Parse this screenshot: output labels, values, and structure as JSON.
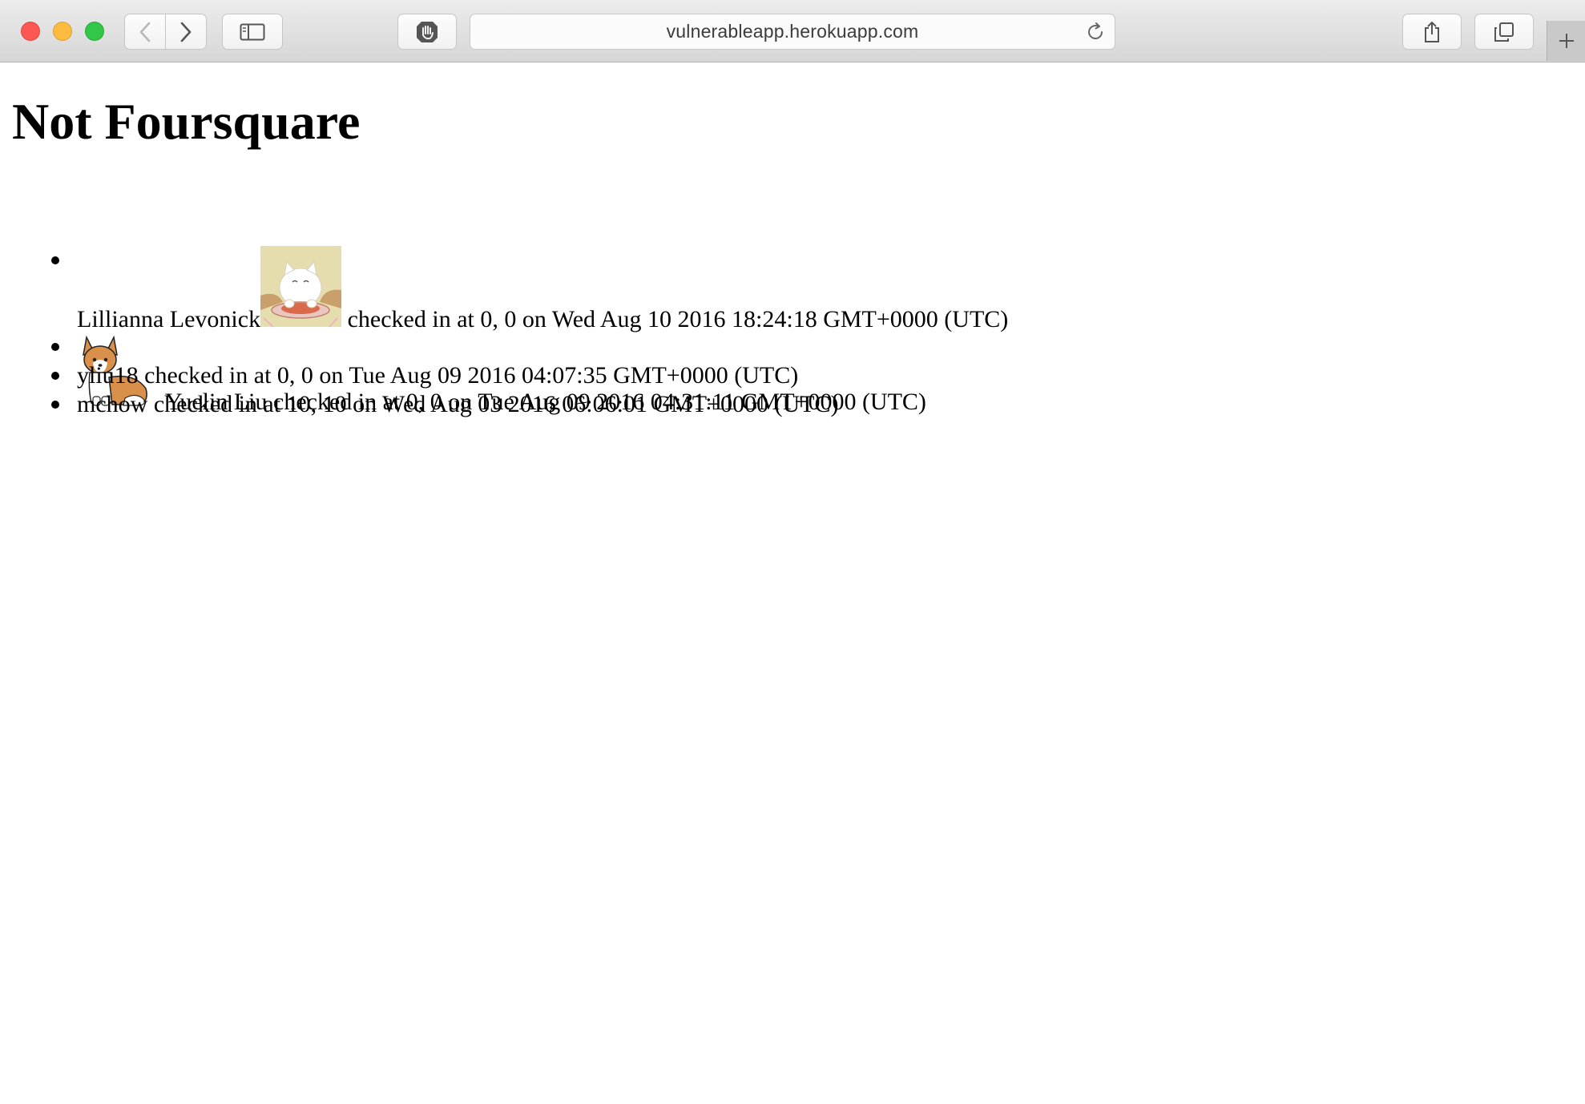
{
  "browser": {
    "url": "vulnerableapp.herokuapp.com"
  },
  "page": {
    "title": "Not Foursquare",
    "checkins": [
      {
        "name": "Lillianna Levonick",
        "avatar": "white-cat-avatar",
        "text": " checked in at 0, 0 on Wed Aug 10 2016 18:24:18 GMT+0000 (UTC)"
      },
      {
        "name": "Yuelin Liu",
        "avatar": "corgi-avatar",
        "text": " checked in at 0, 0 on Tue Aug 09 2016 04:31:11 GMT+0000 (UTC)"
      },
      {
        "name": "yliu18",
        "text": " checked in at 0, 0 on Tue Aug 09 2016 04:07:35 GMT+0000 (UTC)"
      },
      {
        "name": "mchow",
        "text": " checked in at 10, 10 on Wed Aug 03 2016 06:06:01 GMT+0000 (UTC)"
      }
    ]
  }
}
